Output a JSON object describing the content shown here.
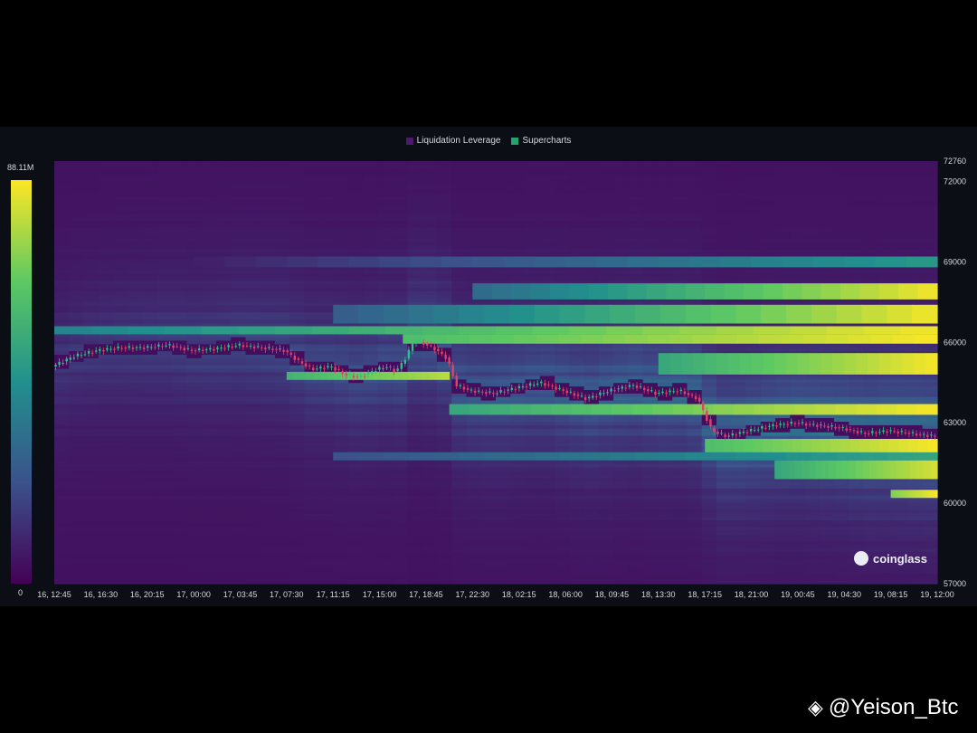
{
  "chart_data": {
    "type": "heatmap",
    "legend": [
      {
        "label": "Liquidation Leverage",
        "color": "#4a1a6e"
      },
      {
        "label": "Supercharts",
        "color": "#26a36d"
      }
    ],
    "colorbar": {
      "max_label": "88.11M",
      "min_label": "0"
    },
    "y_axis": {
      "ticks": [
        "72760",
        "72000",
        "69000",
        "66000",
        "63000",
        "60000",
        "57000"
      ],
      "range": [
        57000,
        72760
      ]
    },
    "x_axis": {
      "ticks": [
        "16, 12:45",
        "16, 16:30",
        "16, 20:15",
        "17, 00:00",
        "17, 03:45",
        "17, 07:30",
        "17, 11:15",
        "17, 15:00",
        "17, 18:45",
        "17, 22:30",
        "18, 02:15",
        "18, 06:00",
        "18, 09:45",
        "18, 13:30",
        "18, 17:15",
        "18, 21:00",
        "19, 00:45",
        "19, 04:30",
        "19, 08:15",
        "19, 12:00"
      ]
    },
    "price_path": [
      {
        "t": 0.0,
        "p": 65100
      },
      {
        "t": 0.5,
        "p": 65500
      },
      {
        "t": 1.0,
        "p": 65700
      },
      {
        "t": 1.5,
        "p": 65800
      },
      {
        "t": 2.0,
        "p": 65800
      },
      {
        "t": 2.5,
        "p": 65900
      },
      {
        "t": 3.0,
        "p": 65700
      },
      {
        "t": 3.5,
        "p": 65750
      },
      {
        "t": 4.0,
        "p": 65900
      },
      {
        "t": 4.5,
        "p": 65800
      },
      {
        "t": 5.0,
        "p": 65700
      },
      {
        "t": 5.3,
        "p": 65300
      },
      {
        "t": 5.6,
        "p": 65000
      },
      {
        "t": 6.0,
        "p": 65100
      },
      {
        "t": 6.3,
        "p": 64800
      },
      {
        "t": 6.6,
        "p": 64700
      },
      {
        "t": 7.0,
        "p": 65000
      },
      {
        "t": 7.2,
        "p": 65100
      },
      {
        "t": 7.4,
        "p": 64900
      },
      {
        "t": 7.6,
        "p": 65400
      },
      {
        "t": 7.8,
        "p": 66100
      },
      {
        "t": 8.2,
        "p": 65800
      },
      {
        "t": 8.5,
        "p": 65400
      },
      {
        "t": 8.7,
        "p": 64400
      },
      {
        "t": 9.0,
        "p": 64200
      },
      {
        "t": 9.5,
        "p": 64100
      },
      {
        "t": 10.0,
        "p": 64300
      },
      {
        "t": 10.5,
        "p": 64500
      },
      {
        "t": 11.0,
        "p": 64200
      },
      {
        "t": 11.5,
        "p": 63900
      },
      {
        "t": 12.0,
        "p": 64200
      },
      {
        "t": 12.5,
        "p": 64400
      },
      {
        "t": 13.0,
        "p": 64100
      },
      {
        "t": 13.5,
        "p": 64200
      },
      {
        "t": 13.9,
        "p": 63900
      },
      {
        "t": 14.2,
        "p": 62700
      },
      {
        "t": 14.5,
        "p": 62500
      },
      {
        "t": 15.0,
        "p": 62700
      },
      {
        "t": 15.5,
        "p": 62900
      },
      {
        "t": 16.0,
        "p": 63000
      },
      {
        "t": 16.5,
        "p": 62900
      },
      {
        "t": 17.0,
        "p": 62800
      },
      {
        "t": 17.5,
        "p": 62600
      },
      {
        "t": 18.0,
        "p": 62700
      },
      {
        "t": 18.5,
        "p": 62600
      },
      {
        "t": 19.0,
        "p": 62500
      }
    ],
    "liquidation_clusters": [
      {
        "from_t": 0.0,
        "to_t": 19.0,
        "low": 66300,
        "high": 66600,
        "start": 0.45,
        "end": 1.0
      },
      {
        "from_t": 7.5,
        "to_t": 19.0,
        "low": 65950,
        "high": 66300,
        "start": 0.7,
        "end": 1.0
      },
      {
        "from_t": 9.0,
        "to_t": 19.0,
        "low": 67600,
        "high": 68200,
        "start": 0.35,
        "end": 1.0
      },
      {
        "from_t": 3.0,
        "to_t": 19.0,
        "low": 68800,
        "high": 69200,
        "start": 0.1,
        "end": 0.55
      },
      {
        "from_t": 6.0,
        "to_t": 19.0,
        "low": 66700,
        "high": 67400,
        "start": 0.3,
        "end": 1.0
      },
      {
        "from_t": 5.0,
        "to_t": 8.5,
        "low": 64600,
        "high": 64900,
        "start": 0.65,
        "end": 0.9
      },
      {
        "from_t": 8.5,
        "to_t": 19.0,
        "low": 63300,
        "high": 63700,
        "start": 0.6,
        "end": 1.0
      },
      {
        "from_t": 13.0,
        "to_t": 19.0,
        "low": 64800,
        "high": 65600,
        "start": 0.6,
        "end": 1.0
      },
      {
        "from_t": 14.0,
        "to_t": 19.0,
        "low": 61800,
        "high": 62400,
        "start": 0.7,
        "end": 1.0
      },
      {
        "from_t": 15.5,
        "to_t": 19.0,
        "low": 60900,
        "high": 61600,
        "start": 0.6,
        "end": 0.95
      },
      {
        "from_t": 18.0,
        "to_t": 19.0,
        "low": 60200,
        "high": 60500,
        "start": 0.8,
        "end": 1.0
      },
      {
        "from_t": 6.0,
        "to_t": 19.0,
        "low": 61600,
        "high": 61900,
        "start": 0.25,
        "end": 0.6
      }
    ]
  },
  "watermark": {
    "brand": "coinglass",
    "handle": "@Yeison_Btc"
  }
}
